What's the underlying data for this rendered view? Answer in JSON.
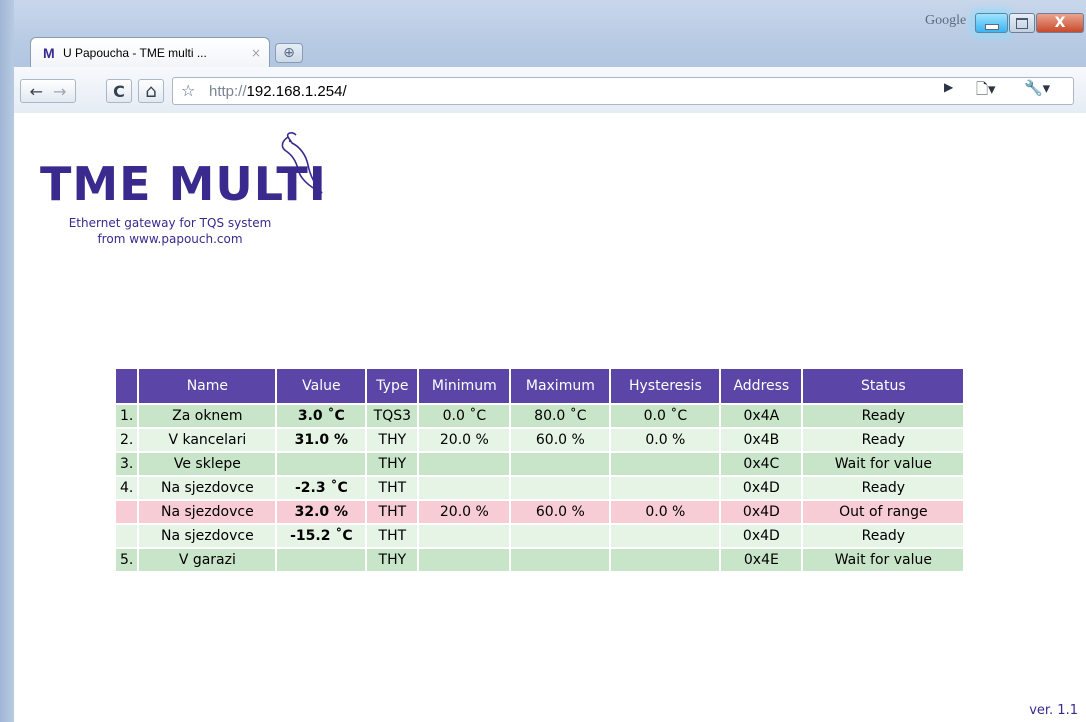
{
  "window": {
    "title_brand": "Google"
  },
  "tab": {
    "favicon": "M",
    "title": "U Papoucha - TME multi ...",
    "close": "×"
  },
  "omnibox": {
    "scheme": "http://",
    "host": "192.168.1.254/"
  },
  "logo": {
    "main": "TME MULTI",
    "sub_line1": "Ethernet gateway for TQS system",
    "sub_line2": "from www.papouch.com"
  },
  "table": {
    "headers": [
      "",
      "Name",
      "Value",
      "Type",
      "Minimum",
      "Maximum",
      "Hysteresis",
      "Address",
      "Status"
    ],
    "rows": [
      {
        "idx": "1.",
        "name": "Za oknem",
        "value": "3.0 ˚C",
        "type": "TQS3",
        "min": "0.0 ˚C",
        "max": "80.0 ˚C",
        "hyst": "0.0 ˚C",
        "addr": "0x4A",
        "status": "Ready",
        "state": "ok"
      },
      {
        "idx": "2.",
        "name": "V kancelari",
        "value": "31.0 %",
        "type": "THY",
        "min": "20.0 %",
        "max": "60.0 %",
        "hyst": "0.0 %",
        "addr": "0x4B",
        "status": "Ready",
        "state": "light"
      },
      {
        "idx": "3.",
        "name": "Ve sklepe",
        "value": "",
        "type": "THY",
        "min": "",
        "max": "",
        "hyst": "",
        "addr": "0x4C",
        "status": "Wait for value",
        "state": "ok"
      },
      {
        "idx": "4.",
        "name": "Na sjezdovce",
        "value": "-2.3 ˚C",
        "type": "THT",
        "min": "",
        "max": "",
        "hyst": "",
        "addr": "0x4D",
        "status": "Ready",
        "state": "light"
      },
      {
        "idx": "",
        "name": "Na sjezdovce",
        "value": "32.0 %",
        "type": "THT",
        "min": "20.0 %",
        "max": "60.0 %",
        "hyst": "0.0 %",
        "addr": "0x4D",
        "status": "Out of range",
        "state": "err"
      },
      {
        "idx": "",
        "name": "Na sjezdovce",
        "value": "-15.2 ˚C",
        "type": "THT",
        "min": "",
        "max": "",
        "hyst": "",
        "addr": "0x4D",
        "status": "Ready",
        "state": "light"
      },
      {
        "idx": "5.",
        "name": "V garazi",
        "value": "",
        "type": "THY",
        "min": "",
        "max": "",
        "hyst": "",
        "addr": "0x4E",
        "status": "Wait for value",
        "state": "ok"
      }
    ]
  },
  "footer": {
    "version": "ver. 1.1"
  },
  "icons": {
    "back": "←",
    "forward": "→",
    "reload": "C",
    "home": "⌂",
    "star": "☆",
    "go": "▶",
    "page": "🗋▾",
    "wrench": "🔧▾",
    "new_tab": "⊕"
  },
  "colors": {
    "brand": "#3a2a8e",
    "header_bg": "#5b45a6",
    "row_ok": "#c9e5c9",
    "row_light": "#e5f4e5",
    "row_error": "#f7ccd4"
  }
}
